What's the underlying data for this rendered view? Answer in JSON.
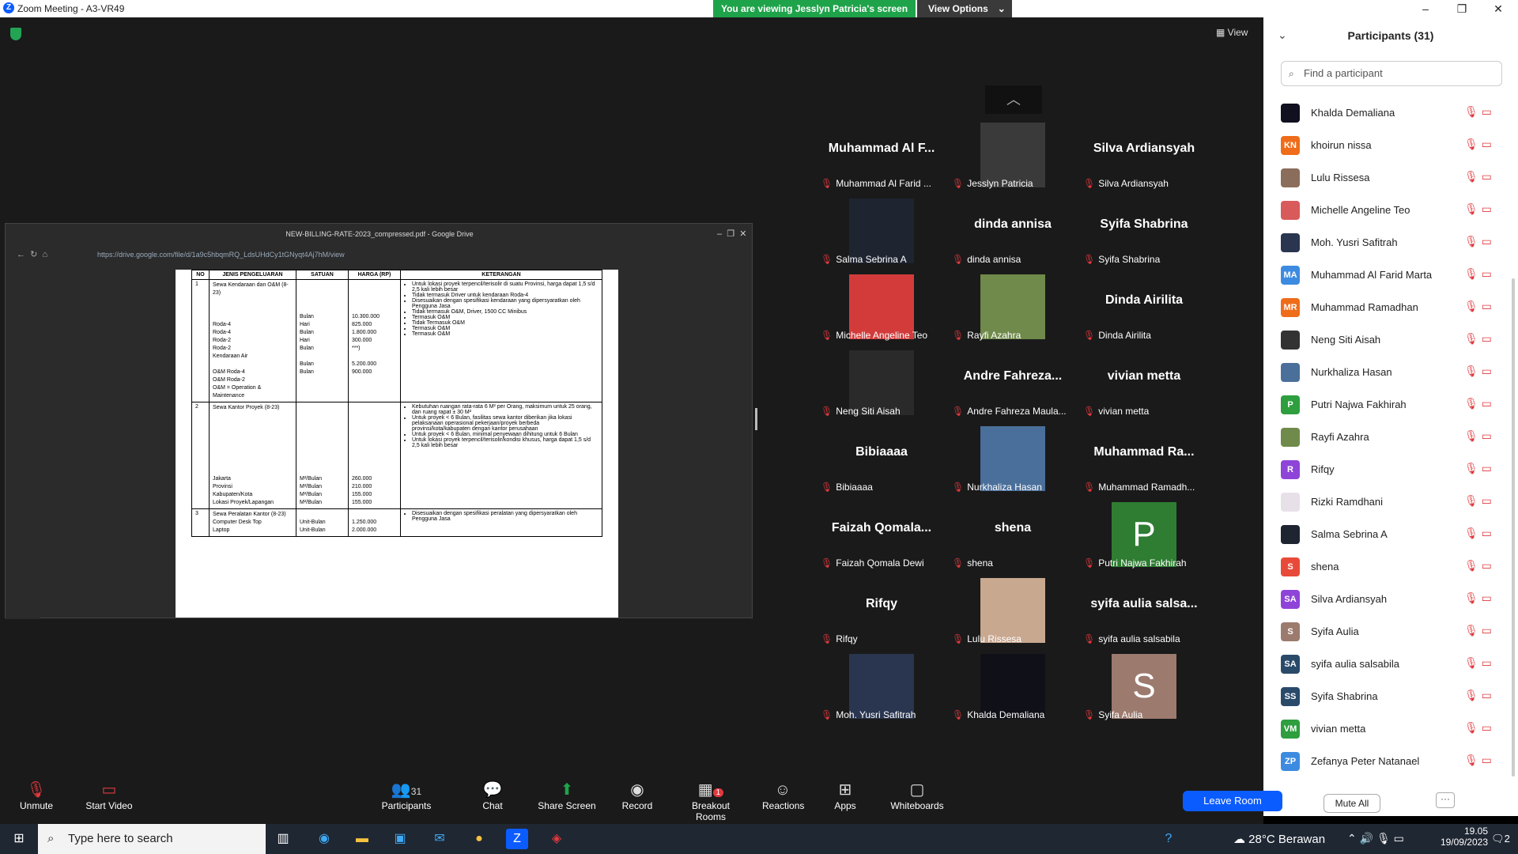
{
  "window": {
    "title": "Zoom Meeting - A3-VR49"
  },
  "banner": {
    "viewing": "You are viewing Jesslyn Patricia's screen",
    "view_options": "View Options"
  },
  "view_label": "View",
  "browser": {
    "title": "NEW-BILLING-RATE-2023_compressed.pdf - Google Drive",
    "url": "https://drive.google.com/file/d/1a9c5hbqmRQ_LdsUHdCy1tGNyqt4Aj7hM/view"
  },
  "doc": {
    "headers": [
      "NO",
      "JENIS PENGELUARAN",
      "SATUAN",
      "HARGA (RP)",
      "KETERANGAN"
    ],
    "rows": [
      {
        "no": "1",
        "jenis": [
          "Sewa Kendaraan dan O&M (8-23)",
          "",
          "",
          "",
          "Roda-4",
          "Roda-4",
          "Roda-2",
          "Roda-2",
          "Kendaraan Air",
          "",
          "O&M Roda-4",
          "O&M Roda-2",
          "O&M = Operation & Maintenance"
        ],
        "satuan": [
          "",
          "",
          "",
          "",
          "Bulan",
          "Hari",
          "Bulan",
          "Hari",
          "Bulan",
          "",
          "Bulan",
          "Bulan"
        ],
        "harga": [
          "",
          "",
          "",
          "",
          "10.300.000",
          "825.000",
          "1.800.000",
          "300.000",
          "***)",
          "",
          "5.200.000",
          "900.000"
        ],
        "ket": [
          "Untuk lokasi proyek terpencil/terisolir di suatu Provinsi, harga dapat 1,5 s/d 2,5 kali lebih besar",
          "Tidak termasuk Driver untuk kendaraan Roda-4",
          "Disesuaikan dengan spesifikasi kendaraan yang dipersyaratkan oleh Pengguna Jasa",
          "Tidak termasuk O&M, Driver, 1500 CC Minibus",
          "Termasuk O&M",
          "Tidak Termasuk O&M",
          "Termasuk O&M",
          "Termasuk O&M"
        ]
      },
      {
        "no": "2",
        "jenis": [
          "Sewa Kantor Proyek (8-23)",
          "",
          "",
          "",
          "",
          "",
          "",
          "",
          "",
          "Jakarta",
          "Provinsi",
          "Kabupaten/Kota",
          "Lokasi Proyek/Lapangan"
        ],
        "satuan": [
          "",
          "",
          "",
          "",
          "",
          "",
          "",
          "",
          "",
          "M²/Bulan",
          "M²/Bulan",
          "M²/Bulan",
          "M²/Bulan"
        ],
        "harga": [
          "",
          "",
          "",
          "",
          "",
          "",
          "",
          "",
          "",
          "260.000",
          "210.000",
          "155.000",
          "155.000"
        ],
        "ket": [
          "Kebutuhan ruangan rata-rata 6 M² per Orang, maksimum untuk 25 orang, dan ruang rapat ± 30 M²",
          "Untuk proyek < 6 Bulan, fasilitas sewa kantor diberikan jika lokasi pelaksanaan operasional pekerjaan/proyek berbeda provinsi/kota/kabupaten dengan kantor perusahaan",
          "Untuk proyek < 6 Bulan, minimal penyewaan dihitung untuk 6 Bulan",
          "Untuk lokasi proyek terpencil/terisolir/kondisi khusus, harga dapat 1,5 s/d 2,5 kali lebih besar"
        ]
      },
      {
        "no": "3",
        "jenis": [
          "Sewa Peralatan Kantor (8-23)",
          "Computer Desk Top",
          "Laptop"
        ],
        "satuan": [
          "",
          "Unit-Bulan",
          "Unit-Bulan"
        ],
        "harga": [
          "",
          "1.250.000",
          "2.000.000"
        ],
        "ket": [
          "Disesuaikan dengan spesifikasi peralatan yang dipersyaratkan oleh Pengguna Jasa"
        ]
      }
    ]
  },
  "tiles": [
    {
      "big": "Muhammad Al F...",
      "name": "Muhammad Al Farid ..."
    },
    {
      "big": "",
      "name": "Jesslyn Patricia",
      "pic": "#3a3a3a"
    },
    {
      "big": "Silva Ardiansyah",
      "name": "Silva Ardiansyah"
    },
    {
      "big": "",
      "name": "Salma Sebrina A",
      "pic": "#1e2430"
    },
    {
      "big": "dinda annisa",
      "name": "dinda annisa"
    },
    {
      "big": "Syifa Shabrina",
      "name": "Syifa Shabrina"
    },
    {
      "big": "",
      "name": "Michelle Angeline Teo",
      "pic": "#d33b3b"
    },
    {
      "big": "",
      "name": "Rayfi Azahra",
      "pic": "#6f8a4a"
    },
    {
      "big": "Dinda Airilita",
      "name": "Dinda Airilita"
    },
    {
      "big": "",
      "name": "Neng Siti Aisah",
      "pic": "#2a2a2a"
    },
    {
      "big": "Andre Fahreza...",
      "name": "Andre Fahreza Maula..."
    },
    {
      "big": "vivian metta",
      "name": "vivian metta"
    },
    {
      "big": "Bibiaaaa",
      "name": "Bibiaaaa"
    },
    {
      "big": "",
      "name": "Nurkhaliza Hasan",
      "pic": "#4a6f9a"
    },
    {
      "big": "Muhammad Ra...",
      "name": "Muhammad Ramadh..."
    },
    {
      "big": "Faizah Qomala...",
      "name": "Faizah Qomala Dewi"
    },
    {
      "big": "shena",
      "name": "shena"
    },
    {
      "big": "",
      "name": "Putri Najwa Fakhirah",
      "letter": "P",
      "pic": "#2e7d32"
    },
    {
      "big": "Rifqy",
      "name": "Rifqy"
    },
    {
      "big": "",
      "name": "Lulu Rissesa",
      "pic": "#c9a890"
    },
    {
      "big": "syifa aulia salsa...",
      "name": "syifa aulia salsabila"
    },
    {
      "big": "",
      "name": "Moh. Yusri Safitrah",
      "pic": "#2a3550"
    },
    {
      "big": "",
      "name": "Khalda Demaliana",
      "pic": "#101018"
    },
    {
      "big": "",
      "name": "Syifa Aulia",
      "letter": "S",
      "pic": "#9c7a6e"
    }
  ],
  "panel": {
    "title": "Participants (31)",
    "search_placeholder": "Find a participant",
    "mute_all": "Mute All",
    "more": "···",
    "participants": [
      {
        "name": "Khalda Demaliana",
        "av": "",
        "color": "#101020"
      },
      {
        "name": "khoirun nissa",
        "av": "KN",
        "color": "#ef6c1a"
      },
      {
        "name": "Lulu Rissesa",
        "av": "",
        "color": "#8a6d5a"
      },
      {
        "name": "Michelle Angeline Teo",
        "av": "",
        "color": "#d85a5a"
      },
      {
        "name": "Moh. Yusri Safitrah",
        "av": "",
        "color": "#2a3550"
      },
      {
        "name": "Muhammad Al Farid Marta",
        "av": "MA",
        "color": "#3d8be0"
      },
      {
        "name": "Muhammad Ramadhan",
        "av": "MR",
        "color": "#ef6c1a"
      },
      {
        "name": "Neng Siti Aisah",
        "av": "",
        "color": "#333"
      },
      {
        "name": "Nurkhaliza Hasan",
        "av": "",
        "color": "#4a6f9a"
      },
      {
        "name": "Putri Najwa Fakhirah",
        "av": "P",
        "color": "#2e9e3f"
      },
      {
        "name": "Rayfi Azahra",
        "av": "",
        "color": "#6f8a4a"
      },
      {
        "name": "Rifqy",
        "av": "R",
        "color": "#8e44d8"
      },
      {
        "name": "Rizki Ramdhani",
        "av": "",
        "color": "#e8e0e8"
      },
      {
        "name": "Salma Sebrina A",
        "av": "",
        "color": "#1e2430"
      },
      {
        "name": "shena",
        "av": "S",
        "color": "#e84a3a"
      },
      {
        "name": "Silva Ardiansyah",
        "av": "SA",
        "color": "#8e44d8"
      },
      {
        "name": "Syifa Aulia",
        "av": "S",
        "color": "#9c7a6e"
      },
      {
        "name": "syifa aulia salsabila",
        "av": "SA",
        "color": "#2a4a6a"
      },
      {
        "name": "Syifa Shabrina",
        "av": "SS",
        "color": "#2a4a6a"
      },
      {
        "name": "vivian metta",
        "av": "VM",
        "color": "#2e9e3f"
      },
      {
        "name": "Zefanya Peter Natanael",
        "av": "ZP",
        "color": "#3d8be0"
      }
    ]
  },
  "toolbar": {
    "unmute": "Unmute",
    "start_video": "Start Video",
    "participants": "Participants",
    "participants_count": "31",
    "chat": "Chat",
    "share_screen": "Share Screen",
    "record": "Record",
    "breakout": "Breakout Rooms",
    "breakout_badge": "1",
    "reactions": "Reactions",
    "apps": "Apps",
    "whiteboards": "Whiteboards",
    "leave": "Leave Room"
  },
  "taskbar": {
    "search": "Type here to search",
    "weather": "28°C Berawan",
    "time": "19.05",
    "date": "19/09/2023",
    "notif": "2"
  }
}
